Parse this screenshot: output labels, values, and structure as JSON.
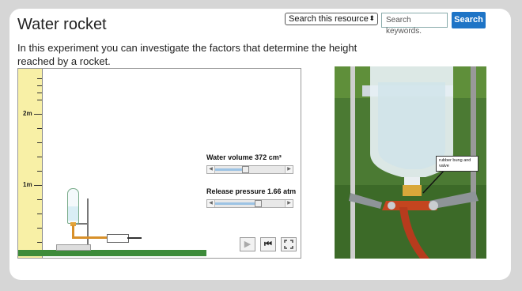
{
  "header": {
    "title": "Water rocket",
    "search_scope": "Search this resource",
    "search_placeholder": "Search keywords.",
    "search_button": "Search"
  },
  "intro": "In this experiment you can investigate the factors that determine the height reached by a rocket.",
  "simulation": {
    "ruler_labels": [
      "2m",
      "1m"
    ],
    "water_volume_label": "Water volume 372 cm³",
    "water_volume_value": 372,
    "water_volume_fraction": 0.43,
    "release_pressure_label": "Release pressure 1.66 atm",
    "release_pressure_value": 1.66,
    "release_pressure_fraction": 0.61,
    "buttons": [
      "play-icon",
      "reset-icon",
      "fullscreen-icon"
    ]
  },
  "photo": {
    "callout": "rubber bung and valve"
  },
  "colors": {
    "accent": "#1e74c6",
    "ruler": "#f8f0a6",
    "ground": "#3d8b3a",
    "grass": "#3f6a2e"
  }
}
